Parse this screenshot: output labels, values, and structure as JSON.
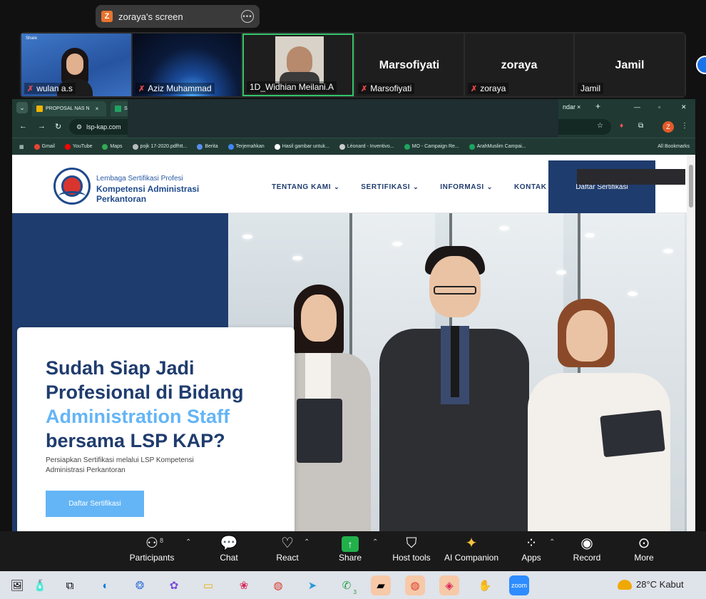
{
  "share_pill": {
    "badge": "Z",
    "text": "zoraya's screen",
    "more": "•••"
  },
  "participants": [
    {
      "name": "wulan a.s",
      "muted": true,
      "tiny_label": "Share"
    },
    {
      "name": "Aziz Muhammad",
      "muted": true
    },
    {
      "name": "1D_Widhian Meilani.A",
      "muted": false,
      "active_speaker": true
    },
    {
      "name": "Marsofiyati",
      "big_label": "Marsofiyati",
      "muted": true
    },
    {
      "name": "zoraya",
      "big_label": "zoraya",
      "muted": true
    },
    {
      "name": "Jamil",
      "big_label": "Jamil",
      "muted": false
    }
  ],
  "browser": {
    "tab1_label": "PROPOSAL NAS N",
    "tab2_label": "S",
    "tab_right": "ndar",
    "url": "lsp-kap.com",
    "bookmarks": [
      "Gmail",
      "YouTube",
      "Maps",
      "pojk 17-2020.pdfhtt...",
      "Berita",
      "Terjemahkan",
      "Hasil gambar untuk...",
      "Léonard - Inventivo...",
      "MO - Campaign Re...",
      "ArahMuslim Campai..."
    ],
    "all_bookmarks": "All Bookmarks",
    "profile_letter": "Z"
  },
  "site": {
    "logo_line1": "Lembaga Sertifikasi Profesi",
    "logo_line2": "Kompetensi Administrasi",
    "logo_line3": "Perkantoran",
    "nav": [
      "TENTANG KAMI",
      "SERTIFIKASI",
      "INFORMASI",
      "KONTAK"
    ],
    "header_cta": "Daftar Sertifikasi",
    "hero_line1": "Sudah Siap Jadi",
    "hero_line2": "Profesional di Bidang",
    "hero_line3": "Administration Staff",
    "hero_line4": "bersama LSP KAP?",
    "hero_sub": "Persiapkan Sertifikasi melalui LSP Kompetensi Administrasi Perkantoran",
    "hero_button": "Daftar Sertifikasi"
  },
  "controls": [
    {
      "label": "Participants",
      "icon": "participants-icon",
      "count": "8"
    },
    {
      "label": "Chat",
      "icon": "chat-icon"
    },
    {
      "label": "React",
      "icon": "heart-icon"
    },
    {
      "label": "Share",
      "icon": "share-icon"
    },
    {
      "label": "Host tools",
      "icon": "shield-icon"
    },
    {
      "label": "AI Companion",
      "icon": "sparkle-icon"
    },
    {
      "label": "Apps",
      "icon": "apps-icon"
    },
    {
      "label": "Record",
      "icon": "record-icon"
    },
    {
      "label": "More",
      "icon": "more-icon"
    }
  ],
  "taskbar": {
    "weather": "28°C  Kabut",
    "whatsapp_badge": "3"
  },
  "colors": {
    "brand_navy": "#1f3c6e",
    "brand_light_blue": "#64b5f6",
    "active_speaker": "#33c46a",
    "share_green": "#22b04b"
  }
}
